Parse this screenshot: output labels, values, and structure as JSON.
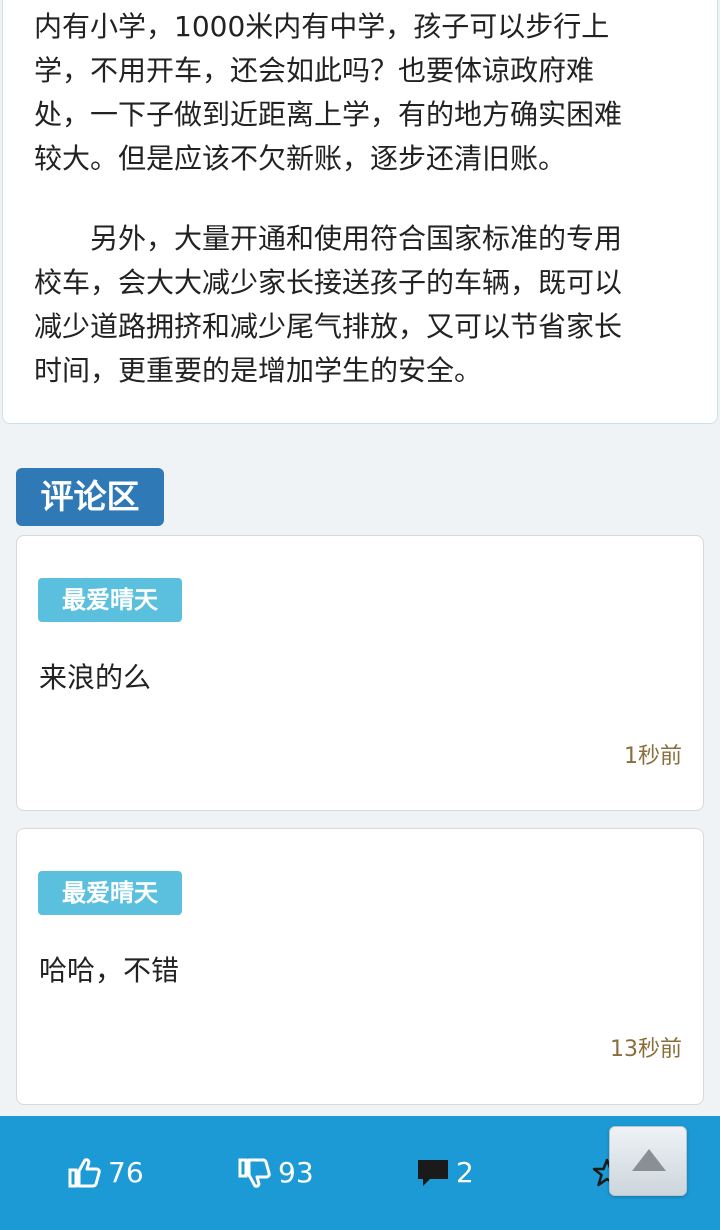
{
  "article": {
    "paragraph1_lines": [
      "内有小学，1000米内有中学，孩子可以步行上",
      "学，不用开车，还会如此吗？也要体谅政府难",
      "处，一下子做到近距离上学，有的地方确实困难",
      "较大。但是应该不欠新账，逐步还清旧账。"
    ],
    "paragraph2_lines": [
      "　　另外，大量开通和使用符合国家标准的专用",
      "校车，会大大减少家长接送孩子的车辆，既可以",
      "减少道路拥挤和减少尾气排放，又可以节省家长",
      "时间，更重要的是增加学生的安全。"
    ]
  },
  "comments_section": {
    "title": "评论区",
    "comments": [
      {
        "user": "最爱晴天",
        "text": "来浪的么",
        "time": "1秒前"
      },
      {
        "user": "最爱晴天",
        "text": "哈哈，不错",
        "time": "13秒前"
      }
    ]
  },
  "bottom_bar": {
    "like_count": "76",
    "dislike_count": "93",
    "comment_count": "2",
    "icons": [
      "thumbs-up-icon",
      "thumbs-down-icon",
      "comment-bubble-icon",
      "star-icon",
      "arrow-up-icon"
    ]
  },
  "colors": {
    "accent_blue": "#1c9ad6",
    "header_blue": "#2f79b7",
    "badge_blue": "#5bc0de",
    "timestamp_brown": "#8a6d3b"
  }
}
